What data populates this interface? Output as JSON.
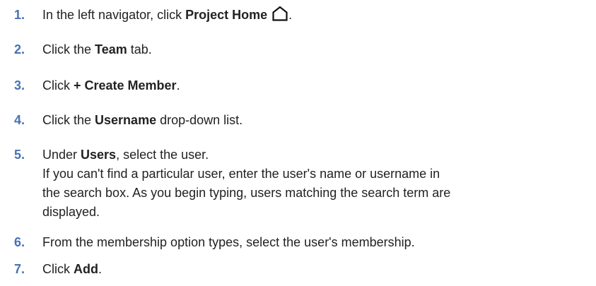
{
  "steps": [
    {
      "number": "1.",
      "before": "In the left navigator, click ",
      "bold": "Project Home",
      "after": ".",
      "icon": "home-icon"
    },
    {
      "number": "2.",
      "before": "Click the ",
      "bold": "Team",
      "after": " tab."
    },
    {
      "number": "3.",
      "before": "Click ",
      "bold": "+ Create Member",
      "after": "."
    },
    {
      "number": "4.",
      "before": "Click the ",
      "bold": "Username",
      "after": " drop-down list."
    },
    {
      "number": "5.",
      "before": "Under ",
      "bold": "Users",
      "after": ", select the user.",
      "lines": [
        "If you can't find a particular user, enter the user's name or username in",
        "the search box. As you begin typing, users matching the search term are",
        "displayed."
      ]
    },
    {
      "number": "6.",
      "text": "From the membership option types, select the user's membership."
    },
    {
      "number": "7.",
      "before": "Click ",
      "bold": "Add",
      "after": "."
    }
  ],
  "colors": {
    "step_number": "#4672b4",
    "text": "#222222"
  }
}
